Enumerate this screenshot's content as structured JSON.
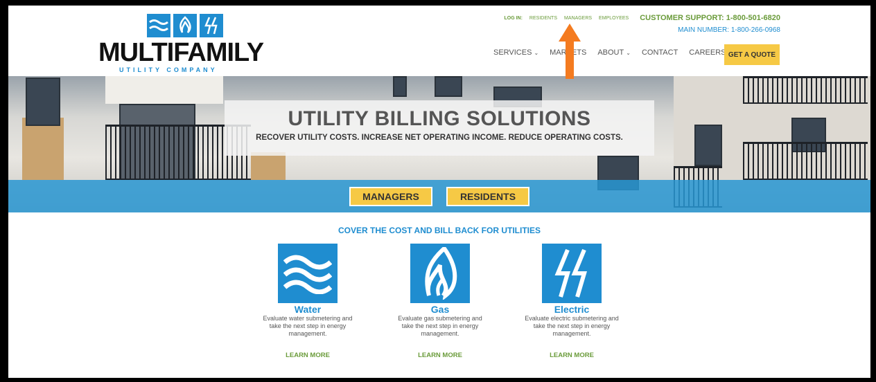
{
  "logo": {
    "word": "MULTIFAMILY",
    "sub": "UTILITY COMPANY"
  },
  "toplinks": {
    "login": "LOG IN:",
    "residents": "RESIDENTS",
    "managers": "MANAGERS",
    "employees": "EMPLOYEES",
    "support": "CUSTOMER SUPPORT: 1-800-501-6820",
    "main_number": "MAIN NUMBER: 1-800-266-0968"
  },
  "nav": {
    "services": "SERVICES",
    "markets": "MARKETS",
    "about": "ABOUT",
    "contact": "CONTACT",
    "careers": "CAREERS",
    "quote": "GET A QUOTE"
  },
  "hero": {
    "title": "UTILITY BILLING SOLUTIONS",
    "subtitle": "RECOVER UTILITY COSTS. INCREASE NET OPERATING INCOME. REDUCE OPERATING COSTS.",
    "managers_btn": "MANAGERS",
    "residents_btn": "RESIDENTS"
  },
  "services": {
    "heading": "COVER THE COST AND BILL BACK FOR UTILITIES",
    "items": [
      {
        "name": "Water",
        "desc": "Evaluate water submetering and take the next step in energy management.",
        "more": "LEARN MORE",
        "icon": "water-icon"
      },
      {
        "name": "Gas",
        "desc": "Evaluate gas submetering and take the next step in energy management.",
        "more": "LEARN MORE",
        "icon": "flame-icon"
      },
      {
        "name": "Electric",
        "desc": "Evaluate electric submetering and take the next step in energy management.",
        "more": "LEARN MORE",
        "icon": "lightning-icon"
      }
    ]
  },
  "colors": {
    "brand_blue": "#1f8dd0",
    "accent_yellow": "#f6c945",
    "link_green": "#6a9b3a",
    "annotation_arrow": "#f47b20"
  }
}
